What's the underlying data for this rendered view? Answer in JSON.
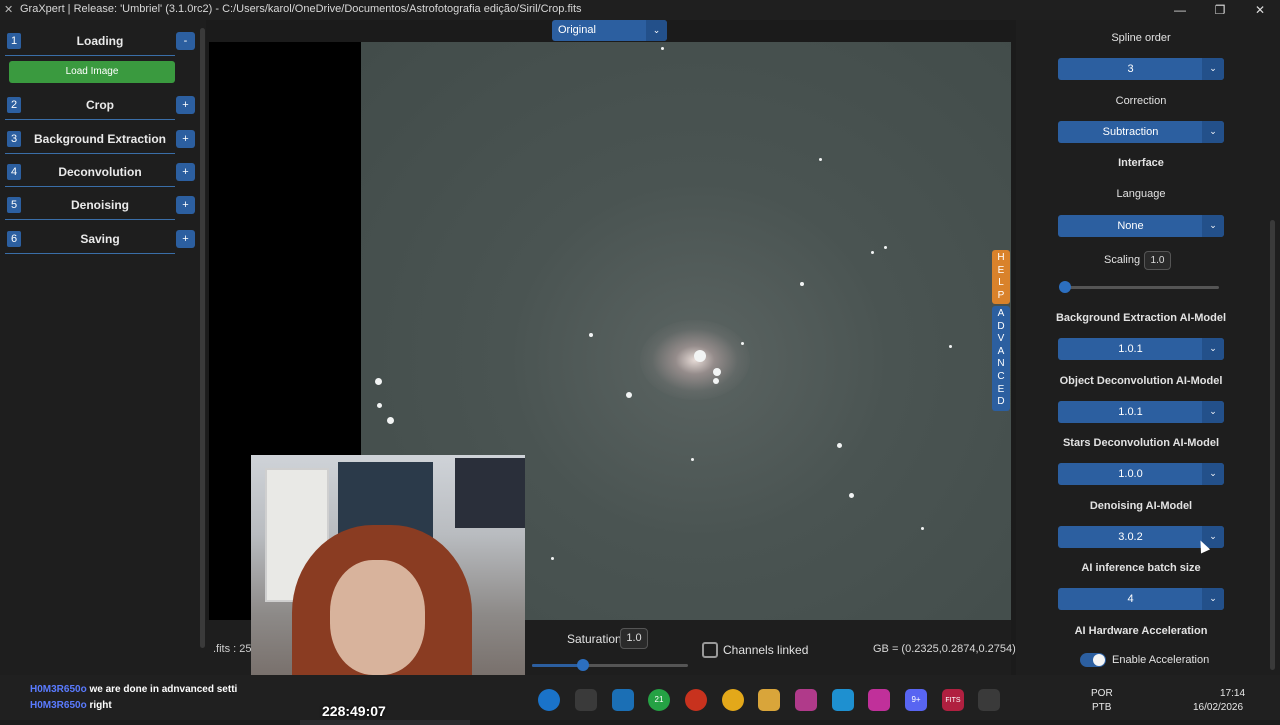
{
  "window": {
    "title": "GraXpert | Release: 'Umbriel' (3.1.0rc2) - C:/Users/karol/OneDrive/Documentos/Astrofotografia edição/Siril/Crop.fits",
    "minimize": "—",
    "maximize": "❐",
    "close": "✕"
  },
  "left_panel": {
    "steps": [
      {
        "num": "1",
        "label": "Loading",
        "toggle": "-"
      },
      {
        "num": "2",
        "label": "Crop",
        "toggle": "+"
      },
      {
        "num": "3",
        "label": "Background Extraction",
        "toggle": "+"
      },
      {
        "num": "4",
        "label": "Deconvolution",
        "toggle": "+"
      },
      {
        "num": "5",
        "label": "Denoising",
        "toggle": "+"
      },
      {
        "num": "6",
        "label": "Saving",
        "toggle": "+"
      }
    ],
    "load_button": "Load Image"
  },
  "view": {
    "display_mode": "Original",
    "help_tab": [
      "H",
      "E",
      "L",
      "P"
    ],
    "advanced_tab": [
      "A",
      "D",
      "V",
      "A",
      "N",
      "C",
      "E",
      "D"
    ]
  },
  "bottom_bar": {
    "file_info": ".fits : 25",
    "saturation_label": "Saturation",
    "saturation_value": "1.0",
    "saturation_level": 0.33,
    "channels_linked_label": "Channels linked",
    "channels_linked": false,
    "rgb_info": "GB = (0.2325,0.2874,0.2754)"
  },
  "right_panel": {
    "spline_order_label": "Spline order",
    "spline_order": "3",
    "correction_label": "Correction",
    "correction": "Subtraction",
    "interface_heading": "Interface",
    "language_label": "Language",
    "language": "None",
    "scaling_label": "Scaling",
    "scaling_value": "1.0",
    "bg_model_label": "Background Extraction AI-Model",
    "bg_model": "1.0.1",
    "obj_deconv_label": "Object Deconvolution AI-Model",
    "obj_deconv": "1.0.1",
    "stars_deconv_label": "Stars Deconvolution AI-Model",
    "stars_deconv": "1.0.0",
    "denoise_label": "Denoising AI-Model",
    "denoise": "3.0.2",
    "batch_label": "AI inference batch size",
    "batch": "4",
    "hw_accel_label": "AI Hardware Acceleration",
    "enable_accel_label": "Enable Acceleration",
    "enable_accel": true,
    "dropdown_arrow": "⌄"
  },
  "overlay": {
    "webcam_timer": "228:49:07",
    "chat": [
      {
        "user": "H0M3R650o",
        "message": "we are done in adnvanced setti"
      },
      {
        "user": "H0M3R650o",
        "message": "right"
      }
    ]
  },
  "taskbar": {
    "whatsapp_badge": "21",
    "discord_badge": "9+",
    "fits_label": "FITS",
    "lang_top": "POR",
    "lang_bottom": "PTB",
    "time": "17:14",
    "date": "16/02/2026"
  }
}
